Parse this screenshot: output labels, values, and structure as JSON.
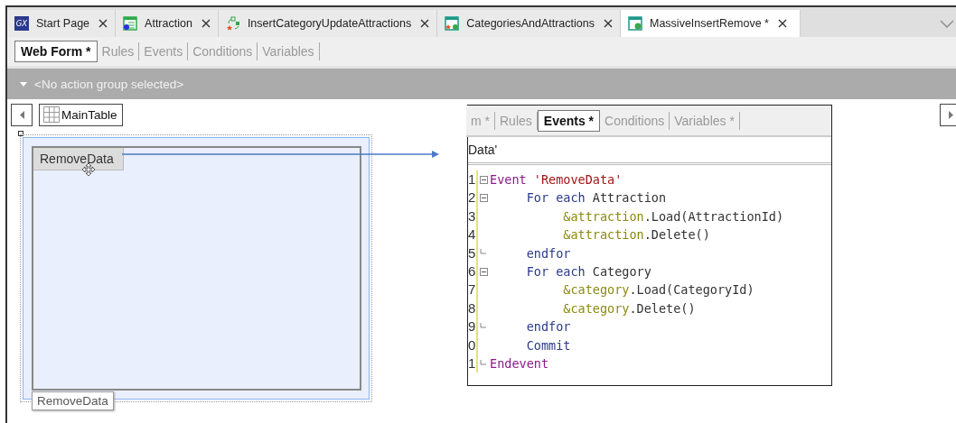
{
  "tabs": [
    {
      "label": "Start Page",
      "kind": "start",
      "logo_text": "GX",
      "selected": false
    },
    {
      "label": "Attraction",
      "kind": "transaction",
      "selected": false
    },
    {
      "label": "InsertCategoryUpdateAttractions",
      "kind": "procedure",
      "selected": false
    },
    {
      "label": "CategoriesAndAttractions",
      "kind": "panelstar",
      "selected": false
    },
    {
      "label": "MassiveInsertRemove *",
      "kind": "panel",
      "selected": true
    }
  ],
  "sub_tabs": [
    {
      "label": "Web Form *",
      "selected": true
    },
    {
      "label": "Rules",
      "selected": false
    },
    {
      "label": "Events",
      "selected": false
    },
    {
      "label": "Conditions",
      "selected": false
    },
    {
      "label": "Variables",
      "selected": false
    }
  ],
  "action_bar": {
    "text": "<No action group selected>"
  },
  "canvas": {
    "table_label": "MainTable",
    "button_label": "RemoveData",
    "tooltip": "RemoveData"
  },
  "events_inset": {
    "sub_tabs": [
      {
        "label": "m *",
        "selected": false
      },
      {
        "label": "Rules",
        "selected": false
      },
      {
        "label": "Events *",
        "selected": true
      },
      {
        "label": "Conditions",
        "selected": false
      },
      {
        "label": "Variables *",
        "selected": false
      }
    ],
    "header": "Data'",
    "lines": [
      {
        "number": "1",
        "kind": "start",
        "tokens": [
          {
            "kind": "keyword",
            "text": "Event "
          },
          {
            "kind": "string",
            "text": "'RemoveData'"
          }
        ]
      },
      {
        "number": "2",
        "kind": "start",
        "tokens": [
          {
            "kind": "command",
            "text": "     For each "
          },
          {
            "kind": "plain",
            "text": "Attraction"
          }
        ]
      },
      {
        "number": "3",
        "kind": "body",
        "tokens": [
          {
            "kind": "variable",
            "text": "          &attraction"
          },
          {
            "kind": "plain",
            "text": ".Load(AttractionId)"
          }
        ]
      },
      {
        "number": "4",
        "kind": "body",
        "tokens": [
          {
            "kind": "variable",
            "text": "          &attraction"
          },
          {
            "kind": "plain",
            "text": ".Delete()"
          }
        ]
      },
      {
        "number": "5",
        "kind": "end",
        "tokens": [
          {
            "kind": "command",
            "text": "     endfor"
          }
        ]
      },
      {
        "number": "6",
        "kind": "start",
        "tokens": [
          {
            "kind": "command",
            "text": "     For each "
          },
          {
            "kind": "plain",
            "text": "Category"
          }
        ]
      },
      {
        "number": "7",
        "kind": "body",
        "tokens": [
          {
            "kind": "variable",
            "text": "          &category"
          },
          {
            "kind": "plain",
            "text": ".Load(CategoryId)"
          }
        ]
      },
      {
        "number": "8",
        "kind": "body",
        "tokens": [
          {
            "kind": "variable",
            "text": "          &category"
          },
          {
            "kind": "plain",
            "text": ".Delete()"
          }
        ]
      },
      {
        "number": "9",
        "kind": "end",
        "tokens": [
          {
            "kind": "command",
            "text": "     endfor"
          }
        ]
      },
      {
        "number": "0",
        "kind": "body",
        "tokens": [
          {
            "kind": "command",
            "text": "     Commit"
          }
        ]
      },
      {
        "number": "1",
        "kind": "end",
        "tokens": [
          {
            "kind": "keyword",
            "text": "Endevent"
          }
        ]
      }
    ]
  }
}
